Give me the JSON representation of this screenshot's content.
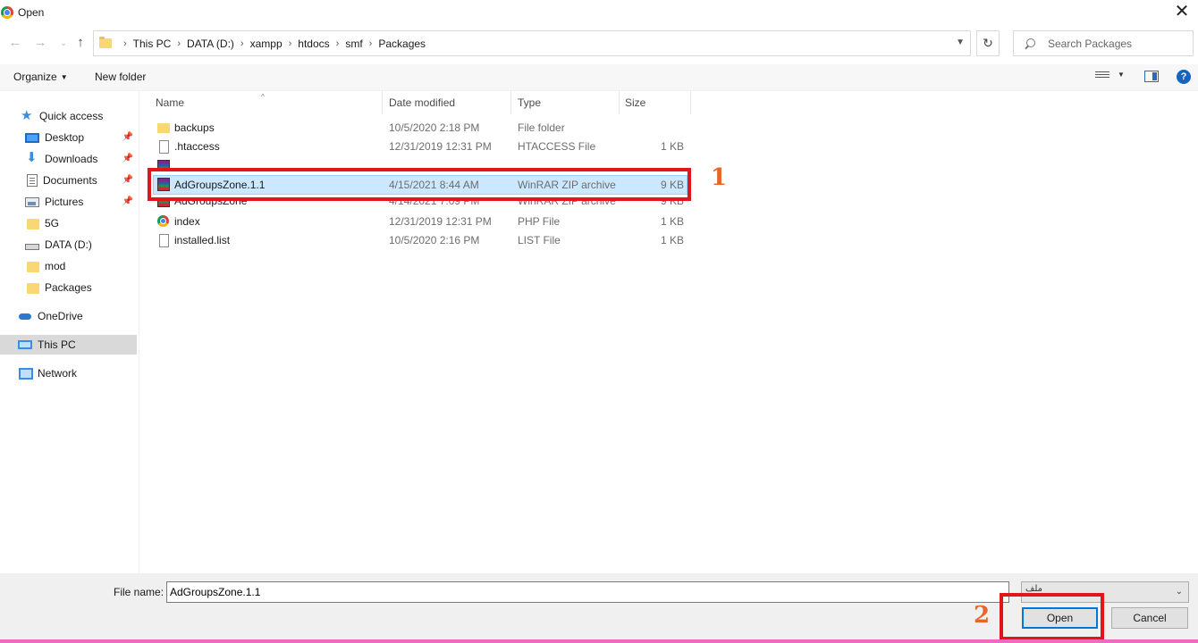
{
  "window": {
    "title": "Open"
  },
  "address": {
    "crumbs": [
      "This PC",
      "DATA (D:)",
      "xampp",
      "htdocs",
      "smf",
      "Packages"
    ]
  },
  "search": {
    "placeholder": "Search Packages"
  },
  "toolbar": {
    "organize": "Organize",
    "new_folder": "New folder"
  },
  "sidebar": {
    "items": [
      {
        "label": "Quick access",
        "icon": "star-icon"
      },
      {
        "label": "Desktop",
        "icon": "desktop-icon",
        "pinned": true
      },
      {
        "label": "Downloads",
        "icon": "download-icon",
        "pinned": true
      },
      {
        "label": "Documents",
        "icon": "document-icon",
        "pinned": true
      },
      {
        "label": "Pictures",
        "icon": "pictures-icon",
        "pinned": true
      },
      {
        "label": "5G",
        "icon": "folder-icon"
      },
      {
        "label": "DATA (D:)",
        "icon": "drive-icon"
      },
      {
        "label": "mod",
        "icon": "folder-icon"
      },
      {
        "label": "Packages",
        "icon": "folder-icon"
      },
      {
        "label": "OneDrive",
        "icon": "cloud-icon"
      },
      {
        "label": "This PC",
        "icon": "computer-icon",
        "selected": true
      },
      {
        "label": "Network",
        "icon": "network-icon"
      }
    ]
  },
  "columns": {
    "name": "Name",
    "date": "Date modified",
    "type": "Type",
    "size": "Size"
  },
  "files": [
    {
      "name": "backups",
      "date": "10/5/2020 2:18 PM",
      "type": "File folder",
      "size": "",
      "icon": "folder-icon"
    },
    {
      "name": ".htaccess",
      "date": "12/31/2019 12:31 PM",
      "type": "HTACCESS File",
      "size": "1 KB",
      "icon": "file-icon"
    },
    {
      "name": "",
      "date": "",
      "type": "",
      "size": "",
      "icon": "winrar-icon",
      "clipped": true
    },
    {
      "name": "AdGroupsZone.1.1",
      "date": "4/15/2021 8:44 AM",
      "type": "WinRAR ZIP archive",
      "size": "9 KB",
      "icon": "winrar-icon",
      "selected": true
    },
    {
      "name": "AdGroupsZone",
      "date": "4/14/2021 7:09 PM",
      "type": "WinRAR ZIP archive",
      "size": "9 KB",
      "icon": "winrar-icon"
    },
    {
      "name": "index",
      "date": "12/31/2019 12:31 PM",
      "type": "PHP File",
      "size": "1 KB",
      "icon": "chrome-icon"
    },
    {
      "name": "installed.list",
      "date": "10/5/2020 2:16 PM",
      "type": "LIST File",
      "size": "1 KB",
      "icon": "file-icon"
    }
  ],
  "annotations": {
    "step1": "1",
    "step2": "2",
    "color": "#e0161b"
  },
  "bottom": {
    "file_name_label": "File name:",
    "file_name_value": "AdGroupsZone.1.1",
    "file_type_value": "ملف",
    "open_label": "Open",
    "cancel_label": "Cancel"
  }
}
